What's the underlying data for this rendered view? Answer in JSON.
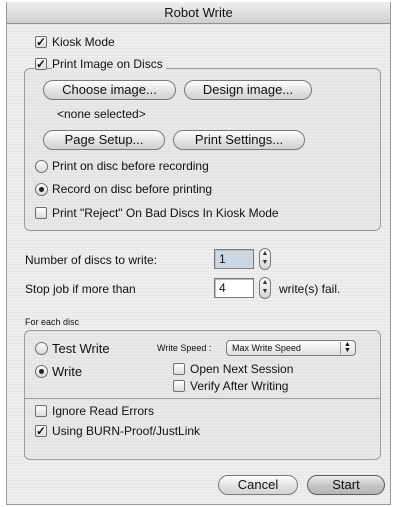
{
  "window": {
    "title": "Robot Write"
  },
  "kiosk": {
    "label": "Kiosk Mode",
    "checked": true
  },
  "print_image": {
    "label": "Print Image on Discs",
    "checked": true,
    "choose_button": "Choose image...",
    "design_button": "Design image...",
    "selection_text": "<none selected>",
    "page_setup_button": "Page Setup...",
    "print_settings_button": "Print Settings...",
    "radio_print_before": "Print on disc before recording",
    "radio_record_before": "Record on disc before printing",
    "selected_order": "record_before",
    "reject_label": "Print \"Reject\" On Bad Discs In Kiosk Mode",
    "reject_checked": false
  },
  "discs": {
    "count_label": "Number of discs to write:",
    "count_value": "1",
    "stop_label": "Stop job if more than",
    "stop_value": "4",
    "stop_suffix": "write(s) fail."
  },
  "each_disc": {
    "section_label": "For each disc",
    "test_write_label": "Test Write",
    "write_label": "Write",
    "selected_mode": "write",
    "write_speed_label": "Write Speed :",
    "write_speed_value": "Max Write Speed",
    "open_next_session_label": "Open Next Session",
    "open_next_session_checked": false,
    "verify_label": "Verify After Writing",
    "verify_checked": false,
    "ignore_errors_label": "Ignore Read Errors",
    "ignore_errors_checked": false,
    "burnproof_label": "Using BURN-Proof/JustLink",
    "burnproof_checked": true
  },
  "footer": {
    "cancel_button": "Cancel",
    "start_button": "Start"
  },
  "icons": {
    "checkmark": "checkmark-icon",
    "stepper": "stepper-arrows-icon",
    "popup": "popup-arrows-icon"
  }
}
